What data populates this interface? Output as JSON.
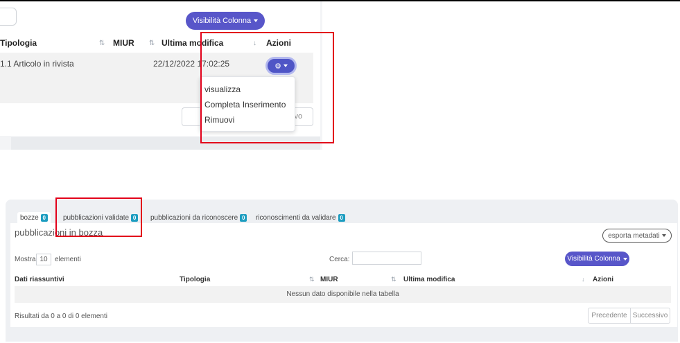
{
  "upper": {
    "column_visibility_label": "Visibilità Colonna",
    "headers": {
      "tipologia": "Tipologia",
      "miur": "MIUR",
      "ultima_modifica": "Ultima modifica",
      "azioni": "Azioni"
    },
    "sort_icons": {
      "neutral": "⇅",
      "desc": "↓"
    },
    "row": {
      "tipologia": "1.1 Articolo in rivista",
      "ultima_modifica": "22/12/2022 17:02:25"
    },
    "gear_icon": "⚙",
    "dropdown_items": [
      "visualizza",
      "Completa Inserimento",
      "Rimuovi"
    ],
    "pager_stub_text": "ivo"
  },
  "tabs": [
    {
      "label": "bozze",
      "count": "0"
    },
    {
      "label": "pubblicazioni validate",
      "count": "0"
    },
    {
      "label": "pubblicazioni da riconoscere",
      "count": "0"
    },
    {
      "label": "riconoscimenti da validare",
      "count": "0"
    }
  ],
  "lower": {
    "section_title": "pubblicazioni in bozza",
    "export_label": "esporta metadati",
    "show_prefix": "Mostra",
    "show_value": "10",
    "show_suffix": "elementi",
    "search_label": "Cerca:",
    "column_visibility_label": "Visibilità Colonna",
    "headers": {
      "dati": "Dati riassuntivi",
      "tipologia": "Tipologia",
      "miur": "MIUR",
      "ultima_modifica": "Ultima modifica",
      "azioni": "Azioni"
    },
    "empty_message": "Nessun dato disponibile nella tabella",
    "results_text": "Risultati da 0 a 0 di 0 elementi",
    "prev_label": "Precedente",
    "next_label": "Successivo"
  },
  "colors": {
    "primary": "#5856c9",
    "badge": "#1d9dc0",
    "highlight": "#e2001a"
  }
}
